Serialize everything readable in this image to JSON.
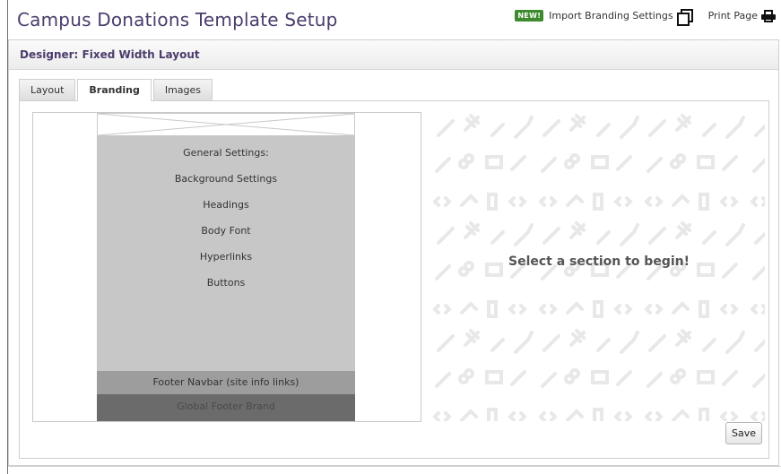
{
  "page": {
    "title": "Campus Donations Template Setup"
  },
  "top_actions": {
    "new_badge": "NEW!",
    "import_label": "Import Branding Settings",
    "import_icon": "copy-icon",
    "print_label": "Print Page",
    "print_icon": "printer-icon",
    "badge_color": "#3d8b2f"
  },
  "designer": {
    "heading": "Designer: Fixed Width Layout"
  },
  "tabs": [
    {
      "label": "Layout",
      "active": false
    },
    {
      "label": "Branding",
      "active": true
    },
    {
      "label": "Images",
      "active": false
    }
  ],
  "preview": {
    "settings_items": [
      "General Settings:",
      "Background Settings",
      "Headings",
      "Body Font",
      "Hyperlinks",
      "Buttons"
    ],
    "footer_navbar": "Footer Navbar (site info links)",
    "global_footer": "Global Footer Brand"
  },
  "main": {
    "prompt": "Select a section to begin!",
    "save_label": "Save"
  },
  "colors": {
    "title": "#4b3c6c",
    "settings_bg": "#c7c7c7",
    "footer_nav_bg": "#9d9d9d",
    "global_footer_bg": "#6b6b6b"
  }
}
